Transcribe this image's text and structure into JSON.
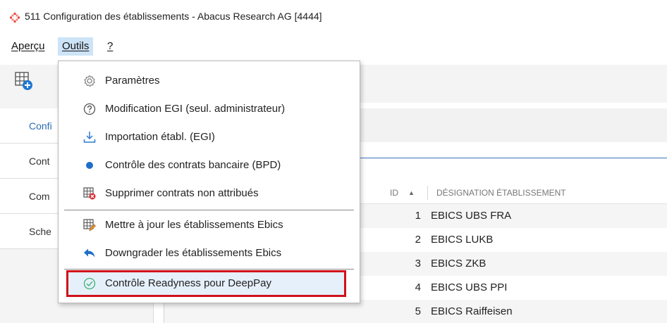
{
  "window": {
    "title": "511 Configuration des établissements - Abacus Research AG [4444]"
  },
  "menubar": {
    "items": [
      {
        "label": "Aperçu"
      },
      {
        "label": "Outils"
      },
      {
        "label": "?"
      }
    ],
    "active": "Outils"
  },
  "sidebar": {
    "items": [
      {
        "label": "Confi"
      },
      {
        "label": "Cont"
      },
      {
        "label": "Com"
      },
      {
        "label": "Sche"
      }
    ]
  },
  "grid": {
    "columns": [
      "ID",
      "DÉSIGNATION ÉTABLISSEMENT"
    ],
    "sort": {
      "column": "ID",
      "direction": "ascending",
      "indicator": "▲"
    },
    "rows": [
      {
        "id": "1",
        "name": "EBICS UBS FRA"
      },
      {
        "id": "2",
        "name": "EBICS LUKB"
      },
      {
        "id": "3",
        "name": "EBICS ZKB"
      },
      {
        "id": "4",
        "name": "EBICS UBS PPI"
      },
      {
        "id": "5",
        "name": "EBICS Raiffeisen"
      }
    ]
  },
  "outils_menu": {
    "items": [
      {
        "label": "Paramètres",
        "icon": "gear-icon"
      },
      {
        "label": "Modification EGI (seul. administrateur)",
        "icon": "help-circle-icon"
      },
      {
        "label": "Importation établ. (EGI)",
        "icon": "download-tray-icon"
      },
      {
        "label": "Contrôle des contrats bancaire (BPD)",
        "icon": "blue-dot-icon"
      },
      {
        "label": "Supprimer contrats non attribués",
        "icon": "table-delete-icon"
      },
      {
        "label": "Mettre à jour les établissements Ebics",
        "icon": "table-edit-icon"
      },
      {
        "label": "Downgrader les établissements Ebics",
        "icon": "undo-arrow-icon"
      },
      {
        "label": "Contrôle Readyness pour DeepPay",
        "icon": "check-circle-icon"
      }
    ],
    "highlighted_item": "Contrôle Readyness pour DeepPay"
  },
  "colors": {
    "accent_blue": "#2c6cb3",
    "highlight_border": "#d0101a",
    "menu_active": "#cde4f7"
  }
}
